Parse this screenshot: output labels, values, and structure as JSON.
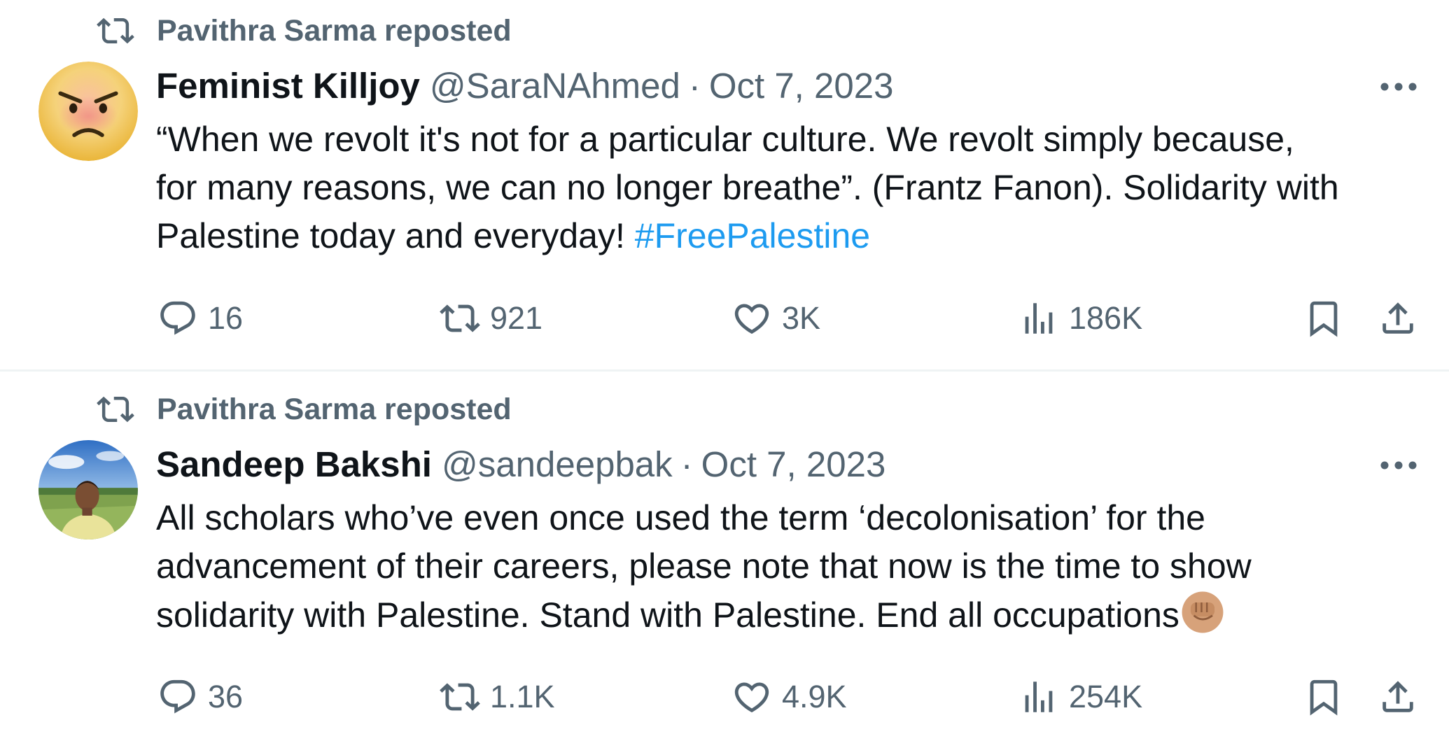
{
  "colors": {
    "text": "#0f1419",
    "secondary": "#536471",
    "link": "#1d9bf0",
    "divider": "#eff3f4"
  },
  "tweets": [
    {
      "repost_label": "Pavithra Sarma reposted",
      "display_name": "Feminist Killjoy",
      "handle": "@SaraNAhmed",
      "separator": "·",
      "date": "Oct 7, 2023",
      "avatar_icon": "angry-face-avatar",
      "text_lines": [
        "“When we revolt it's not for a particular culture. We revolt simply because,",
        "for many reasons, we can no longer breathe”. (Frantz Fanon). Solidarity with",
        "Palestine today and everyday! "
      ],
      "hashtag": "#FreePalestine",
      "actions": {
        "replies": "16",
        "reposts": "921",
        "likes": "3K",
        "views": "186K"
      }
    },
    {
      "repost_label": "Pavithra Sarma reposted",
      "display_name": "Sandeep Bakshi",
      "handle": "@sandeepbak",
      "separator": "·",
      "date": "Oct 7, 2023",
      "avatar_icon": "profile-photo-avatar",
      "text_lines": [
        "All scholars who’ve even once used the term ‘decolonisation’ for the",
        "advancement of their careers, please note that now is the time to show",
        "solidarity with Palestine. Stand with Palestine. End all occupations"
      ],
      "emoji": "raised-fist-emoji",
      "actions": {
        "replies": "36",
        "reposts": "1.1K",
        "likes": "4.9K",
        "views": "254K"
      }
    }
  ]
}
